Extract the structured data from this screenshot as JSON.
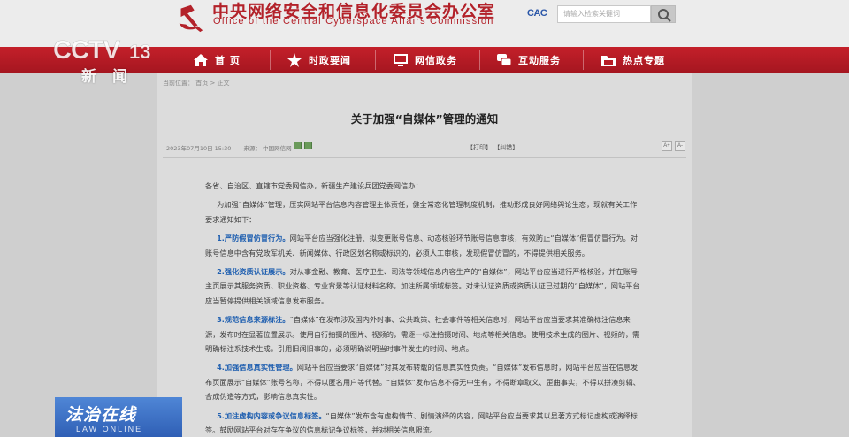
{
  "header": {
    "org_name_cn": "中央网络安全和信息化委员会办公室",
    "org_name_en": "Office of the Central Cyberspace Affairs Commission",
    "cac_logo_text": "CAC",
    "search_placeholder": "请输入检索关键词"
  },
  "nav": {
    "items": [
      {
        "label": "首  页",
        "icon": "home-icon"
      },
      {
        "label": "时政要闻",
        "icon": "star-icon"
      },
      {
        "label": "网信政务",
        "icon": "monitor-icon"
      },
      {
        "label": "互动服务",
        "icon": "chat-icon"
      },
      {
        "label": "热点专题",
        "icon": "folder-icon"
      }
    ]
  },
  "overlay": {
    "channel_logo": "CCTV 13",
    "channel_sub": "新闻",
    "program_cn": "法治在线",
    "program_en": "LAW ONLINE"
  },
  "page": {
    "breadcrumb": "当前位置：  首页 > 正文",
    "title": "关于加强“自媒体”管理的通知",
    "date": "2023年07月10日 15:30",
    "source": "来源：  中国网信网",
    "print_links": "【打印】  【纠错】",
    "font_larger": "A+",
    "font_smaller": "A-"
  },
  "article": {
    "salutation": "各省、自治区、直辖市党委网信办，新疆生产建设兵团党委网信办：",
    "intro": "为加强“自媒体”管理，压实网站平台信息内容管理主体责任，健全常态化管理制度机制，推动形成良好网络舆论生态，现就有关工作要求通知如下：",
    "items": [
      {
        "heading": "1.严防假冒仿冒行为。",
        "text": "网站平台应当强化注册、拟变更账号信息、动态核验环节账号信息审核，有效防止“自媒体”假冒仿冒行为。对账号信息中含有党政军机关、新闻媒体、行政区划名称或标识的，必须人工审核，发现假冒仿冒的，不得提供相关服务。"
      },
      {
        "heading": "2.强化资质认证展示。",
        "text": "对从事金融、教育、医疗卫生、司法等领域信息内容生产的“自媒体”，网站平台应当进行严格核验，并在账号主页展示其服务资质、职业资格、专业背景等认证材料名称，加注所属领域标签。对未认证资质或资质认证已过期的“自媒体”，网站平台应当暂停提供相关领域信息发布服务。"
      },
      {
        "heading": "3.规范信息来源标注。",
        "text": "“自媒体”在发布涉及国内外时事、公共政策、社会事件等相关信息时，网站平台应当要求其准确标注信息来源，发布时在显著位置展示。使用自行拍摄的图片、视频的，需逐一标注拍摄时间、地点等相关信息。使用技术生成的图片、视频的，需明确标注系技术生成。引用旧闻旧事的，必须明确说明当时事件发生的时间、地点。"
      },
      {
        "heading": "4.加强信息真实性管理。",
        "text": "网站平台应当要求“自媒体”对其发布转载的信息真实性负责。“自媒体”发布信息时，网站平台应当在信息发布页面展示“自媒体”账号名称，不得以匿名用户等代替。“自媒体”发布信息不得无中生有，不得断章取义、歪曲事实，不得以拼凑剪辑、合成伪造等方式，影响信息真实性。"
      },
      {
        "heading": "5.加注虚构内容或争议信息标签。",
        "text": "“自媒体”发布含有虚构情节、剧情演绎的内容，网站平台应当要求其以显著方式标记虚构或演绎标签。鼓励网站平台对存在争议的信息标记争议标签，并对相关信息限流。"
      }
    ]
  },
  "colors": {
    "brand_red": "#b3222a",
    "nav_red": "#b81c26",
    "highlight_blue": "#1f5fb0",
    "program_blue": "#3a6fc8"
  }
}
